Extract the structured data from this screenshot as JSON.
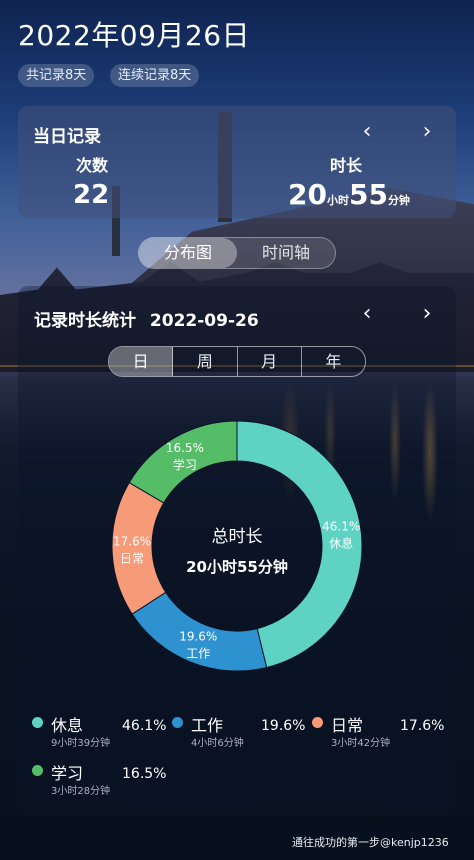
{
  "header": {
    "date": "2022年09月26日",
    "tags": [
      "共记录8天",
      "连续记录8天"
    ]
  },
  "today": {
    "title": "当日记录",
    "prev_icon": "‹",
    "next_icon": "›",
    "count_label": "次数",
    "count_value": "22",
    "duration_label": "时长",
    "duration": {
      "hours": "20",
      "hours_unit": "小时",
      "minutes": "55",
      "minutes_unit": "分钟"
    }
  },
  "view_switch": {
    "options": [
      "分布图",
      "时间轴"
    ],
    "selected": "分布图"
  },
  "stats": {
    "title": "记录时长统计",
    "date": "2022-09-26",
    "prev_icon": "‹",
    "next_icon": "›",
    "periods": [
      "日",
      "周",
      "月",
      "年"
    ],
    "selected_period": "日",
    "center_title": "总时长",
    "center_value": "20小时55分钟"
  },
  "chart_data": {
    "type": "pie",
    "donut": true,
    "total": "20小时55分钟",
    "slices": [
      {
        "name": "休息",
        "percent": 46.1,
        "label": "46.1%",
        "duration": "9小时39分钟",
        "color": "#5fd3c3"
      },
      {
        "name": "工作",
        "percent": 19.6,
        "label": "19.6%",
        "duration": "4小时6分钟",
        "color": "#2f92d0"
      },
      {
        "name": "日常",
        "percent": 17.6,
        "label": "17.6%",
        "duration": "3小时42分钟",
        "color": "#f79a77"
      },
      {
        "name": "学习",
        "percent": 16.5,
        "label": "16.5%",
        "duration": "3小时28分钟",
        "color": "#55bd68"
      }
    ]
  },
  "watermark": "通往成功的第一步@kenjp1236"
}
